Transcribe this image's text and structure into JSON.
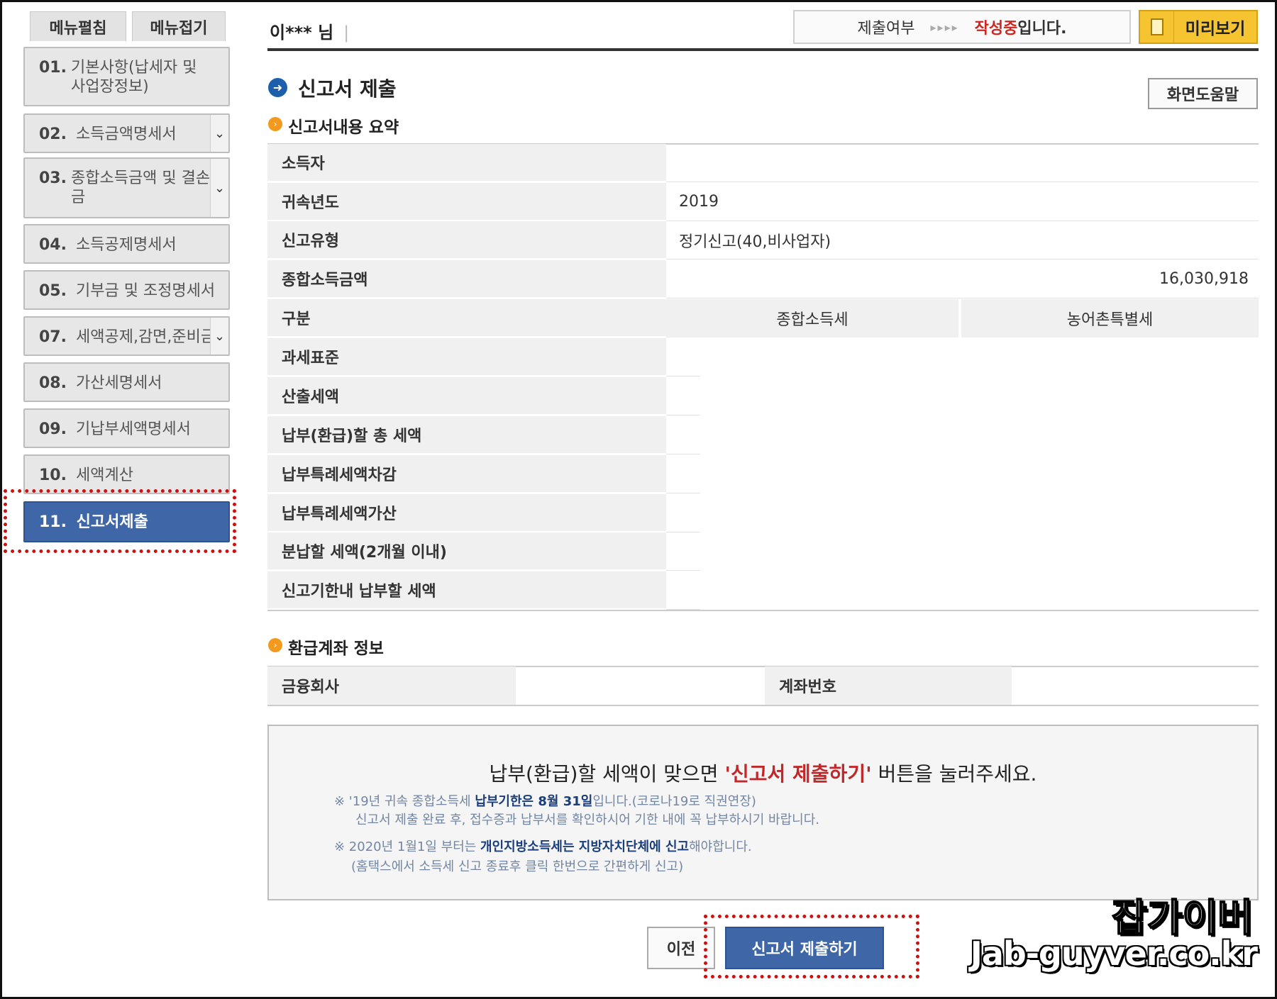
{
  "sidebar": {
    "expand_label": "메뉴펼침",
    "collapse_label": "메뉴접기",
    "items": [
      {
        "num": "01.",
        "label": "기본사항(납세자 및\n사업장정보)"
      },
      {
        "num": "02.",
        "label": "소득금액명세서"
      },
      {
        "num": "03.",
        "label": "종합소득금액 및 결손\n금"
      },
      {
        "num": "04.",
        "label": "소득공제명세서"
      },
      {
        "num": "05.",
        "label": "기부금 및 조정명세서"
      },
      {
        "num": "07.",
        "label": "세액공제,감면,준비금"
      },
      {
        "num": "08.",
        "label": "가산세명세서"
      },
      {
        "num": "09.",
        "label": "기납부세액명세서"
      },
      {
        "num": "10.",
        "label": "세액계산"
      },
      {
        "num": "11.",
        "label": "신고서제출"
      }
    ]
  },
  "header": {
    "user_name": "이*** 님",
    "user_sep": "|",
    "status_label": "제출여부",
    "status_arrows": "▸▸▸▸",
    "status_red": "작성중",
    "status_rest": "입니다.",
    "preview_label": "미리보기"
  },
  "page": {
    "title": "신고서 제출",
    "help_label": "화면도움말"
  },
  "summary": {
    "section_title": "신고서내용 요약",
    "rows": {
      "income_person": {
        "label": "소득자",
        "value": ""
      },
      "year": {
        "label": "귀속년도",
        "value": "2019"
      },
      "report_type": {
        "label": "신고유형",
        "value": "정기신고(40,비사업자)"
      },
      "total_income": {
        "label": "종합소득금액",
        "value": "16,030,918"
      },
      "category": {
        "label": "구분"
      },
      "tax_base": {
        "label": "과세표준"
      },
      "calculated_tax": {
        "label": "산출세액"
      },
      "total_tax": {
        "label": "납부(환급)할 총 세액"
      },
      "special_deduct": {
        "label": "납부특례세액차감"
      },
      "special_add": {
        "label": "납부특례세액가산"
      },
      "installment": {
        "label": "분납할 세액(2개월 이내)"
      },
      "due_tax": {
        "label": "신고기한내 납부할 세액"
      }
    },
    "col_income_tax": "종합소득세",
    "col_rural_tax": "농어촌특별세"
  },
  "refund": {
    "section_title": "환급계좌 정보",
    "bank_label": "금융회사",
    "account_label": "계좌번호"
  },
  "notice": {
    "main_pre": "납부(환급)할 세액이 맞으면 ",
    "main_hl": "'신고서 제출하기'",
    "main_post": " 버튼을 눌러주세요.",
    "line1_pre": "※ '19년 귀속 종합소득세 ",
    "line1_bold": "납부기한은 8월 31일",
    "line1_post": "입니다.(코로나19로 직권연장)",
    "line2": "신고서 제출 완료 후, 접수증과 납부서를 확인하시어 기한 내에 꼭 납부하시기 바랍니다.",
    "line3_pre": "※ 2020년 1월1일 부터는 ",
    "line3_bold1": "개인지방소득세는 지방자치단체에 신고",
    "line3_post": "해야합니다.",
    "line4": "(홈택스에서 소득세 신고 종료후 클릭 한번으로 간편하게 신고)"
  },
  "buttons": {
    "prev_label": "이전",
    "submit_label": "신고서 제출하기"
  },
  "watermark": {
    "line1": "잡가이버",
    "line2": "Jab-guyver.co.kr"
  },
  "colors": {
    "active_blue": "#3f67a8",
    "highlight_red": "#cc1111",
    "preview_yellow": "#f7c431"
  }
}
